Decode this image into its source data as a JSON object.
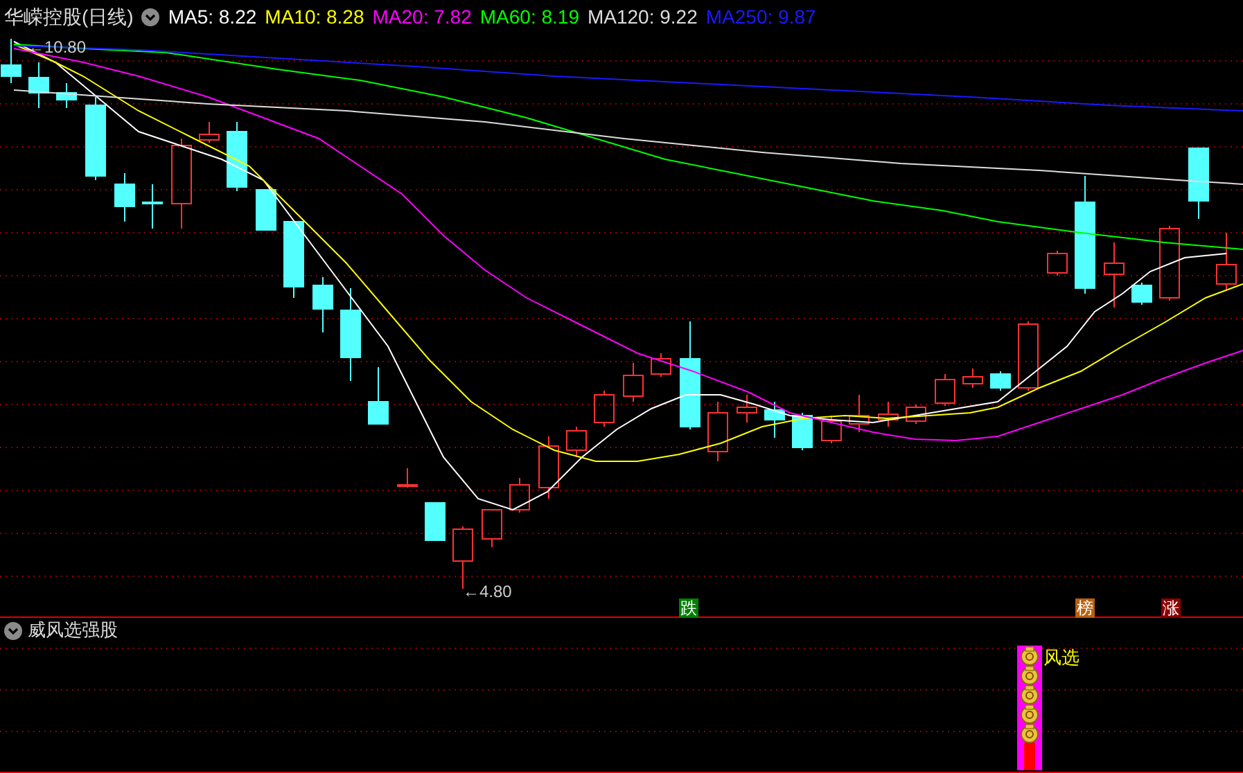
{
  "stock": {
    "title": "华嵘控股(日线)"
  },
  "indicators": [
    {
      "label": "MA5: 8.22",
      "color": "#ffffff"
    },
    {
      "label": "MA10: 8.28",
      "color": "#ffff00"
    },
    {
      "label": "MA20: 7.82",
      "color": "#ff00ff"
    },
    {
      "label": "MA60: 8.19",
      "color": "#00ff00"
    },
    {
      "label": "MA120: 9.22",
      "color": "#dddddd"
    },
    {
      "label": "MA250: 9.87",
      "color": "#1a1aff"
    }
  ],
  "price_labels": {
    "high": "←10.80",
    "low": "←4.80"
  },
  "signals": [
    {
      "label": "跌",
      "color": "#008000"
    },
    {
      "label": "榜",
      "color": "#b8600c"
    },
    {
      "label": "涨",
      "color": "#8b0000"
    }
  ],
  "sub_panel": {
    "title": "威风选强股",
    "signal_label": "风选"
  }
}
